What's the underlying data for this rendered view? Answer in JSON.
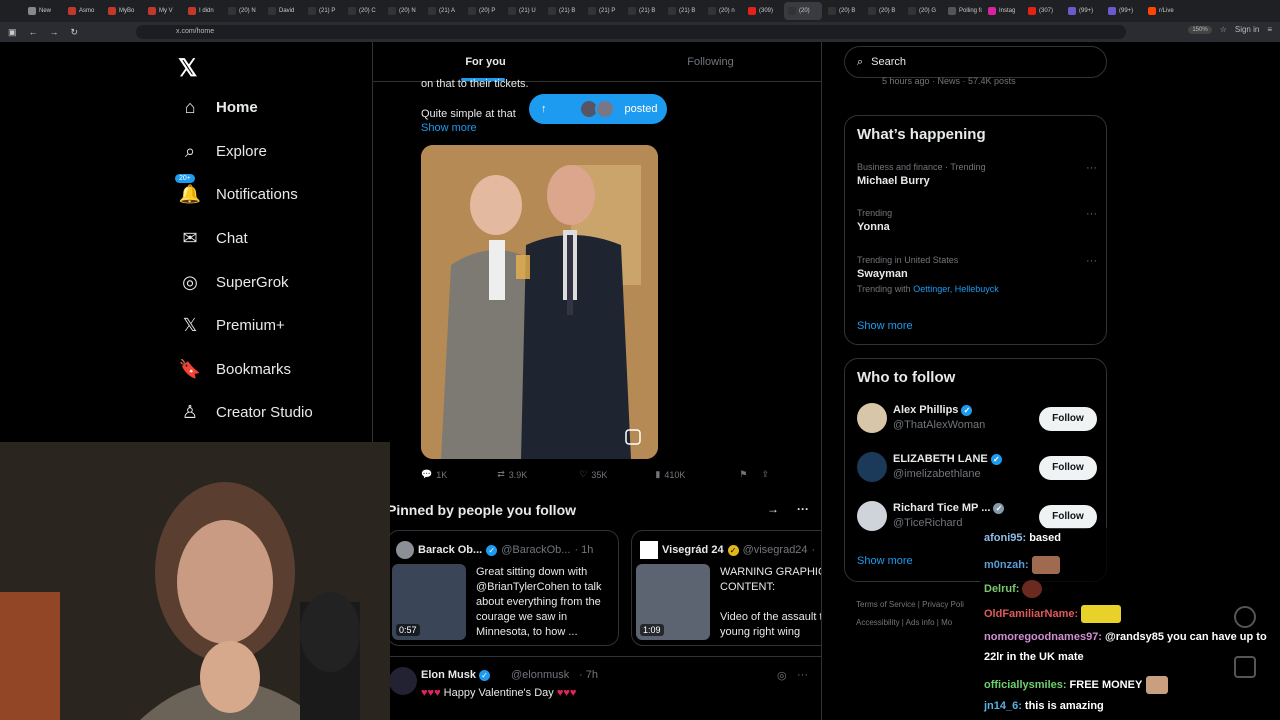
{
  "browser": {
    "tabs": [
      {
        "label": "New",
        "icon": "document-icon",
        "color": "#888"
      },
      {
        "label": "Asmo",
        "icon": "profile-icon",
        "color": "#c0392b"
      },
      {
        "label": "MyBo",
        "icon": "profile-icon",
        "color": "#c0392b"
      },
      {
        "label": "My V",
        "icon": "profile-icon",
        "color": "#c0392b"
      },
      {
        "label": "I didn",
        "icon": "profile-icon",
        "color": "#c0392b"
      },
      {
        "label": "(20) N",
        "icon": "x-icon",
        "color": "#333"
      },
      {
        "label": "David",
        "icon": "x-icon",
        "color": "#333"
      },
      {
        "label": "(21) P",
        "icon": "x-icon",
        "color": "#333"
      },
      {
        "label": "(20) C",
        "icon": "x-icon",
        "color": "#333"
      },
      {
        "label": "(20) N",
        "icon": "x-icon",
        "color": "#333"
      },
      {
        "label": "(21) A",
        "icon": "x-icon",
        "color": "#333"
      },
      {
        "label": "(20) P",
        "icon": "x-icon",
        "color": "#333"
      },
      {
        "label": "(21) U",
        "icon": "x-icon",
        "color": "#333"
      },
      {
        "label": "(21) B",
        "icon": "x-icon",
        "color": "#333"
      },
      {
        "label": "(21) P",
        "icon": "x-icon",
        "color": "#333"
      },
      {
        "label": "(21) B",
        "icon": "x-icon",
        "color": "#333"
      },
      {
        "label": "(21) B",
        "icon": "x-icon",
        "color": "#333"
      },
      {
        "label": "(20) n",
        "icon": "x-icon",
        "color": "#333"
      },
      {
        "label": "(309)",
        "icon": "youtube-icon",
        "color": "#e62117"
      },
      {
        "label": "(20)",
        "icon": "x-icon",
        "color": "#333",
        "active": true
      },
      {
        "label": "(20) B",
        "icon": "x-icon",
        "color": "#333"
      },
      {
        "label": "(20) B",
        "icon": "x-icon",
        "color": "#333"
      },
      {
        "label": "(20) G",
        "icon": "x-icon",
        "color": "#333"
      },
      {
        "label": "Polling fo",
        "icon": "document-icon",
        "color": "#555"
      },
      {
        "label": "Instag",
        "icon": "instagram-icon",
        "color": "#d6249f"
      },
      {
        "label": "(307)",
        "icon": "youtube-icon",
        "color": "#e62117"
      },
      {
        "label": "(99+)",
        "icon": "mail-icon",
        "color": "#6a5acd"
      },
      {
        "label": "(99+)",
        "icon": "mail-icon",
        "color": "#6a5acd"
      },
      {
        "label": "r/Live",
        "icon": "reddit-icon",
        "color": "#ff4500"
      }
    ],
    "url": "x.com/home",
    "zoom": "150%",
    "sign_in": "Sign in"
  },
  "leftnav": {
    "logo": "𝕏",
    "items": [
      {
        "label": "Home",
        "icon": "⌂",
        "name": "home"
      },
      {
        "label": "Explore",
        "icon": "⌕",
        "name": "explore"
      },
      {
        "label": "Notifications",
        "icon": "🔔",
        "name": "notifications",
        "badge": "20+"
      },
      {
        "label": "Chat",
        "icon": "✉",
        "name": "chat"
      },
      {
        "label": "SuperGrok",
        "icon": "◎",
        "name": "supergrok"
      },
      {
        "label": "Premium+",
        "icon": "𝕏",
        "name": "premium"
      },
      {
        "label": "Bookmarks",
        "icon": "🔖",
        "name": "bookmarks"
      },
      {
        "label": "Creator Studio",
        "icon": "♙",
        "name": "creator-studio"
      }
    ]
  },
  "feed": {
    "tabs": [
      "For you",
      "Following"
    ],
    "tweet_text_1": "on that to their tickets.",
    "tweet_text_2": "Quite simple at that",
    "show_more": "Show more",
    "posted_pill": "posted",
    "actions": {
      "replies": "1K",
      "reposts": "3.9K",
      "likes": "35K",
      "views": "410K"
    },
    "pinned_title": "Pinned by people you follow",
    "pinned": [
      {
        "name": "Barack Ob...",
        "handle": "@BarackOb...",
        "time": "· 1h",
        "duration": "0:57",
        "text": "Great sitting down with @BrianTylerCohen to talk about everything from the courage we saw in Minnesota, to how ..."
      },
      {
        "name": "Visegrád 24",
        "handle": "@visegrad24",
        "time": "·",
        "duration": "1:09",
        "text": "WARNING GRAPHIC CONTENT:\n\nVideo of the assault the young right wing"
      }
    ],
    "next_tweet": {
      "name": "Elon Musk",
      "handle": "@elonmusk",
      "time": "· 7h",
      "text": "Happy Valentine's Day"
    }
  },
  "right": {
    "search_placeholder": "Search",
    "prev_meta": "5 hours ago · News · 57.4K posts",
    "whats_happening": "What’s happening",
    "trends": [
      {
        "context": "Business and finance · Trending",
        "name": "Michael Burry"
      },
      {
        "context": "Trending",
        "name": "Yonna"
      },
      {
        "context": "Trending in United States",
        "name": "Swayman",
        "with_label": "Trending with",
        "with_links": "Oettinger, Hellebuyck"
      }
    ],
    "show_more": "Show more",
    "who_to_follow": "Who to follow",
    "follow": [
      {
        "name": "Alex Phillips",
        "handle": "@ThatAlexWoman"
      },
      {
        "name": "ELIZABETH LANE",
        "handle": "@imelizabethlane"
      },
      {
        "name": "Richard Tice MP ...",
        "handle": "@TiceRichard"
      }
    ],
    "follow_label": "Follow",
    "footer": [
      "Terms of Service",
      "Privacy Poli",
      "Accessibility",
      "Ads info",
      "Mo"
    ]
  },
  "chat": [
    {
      "user": "afoni95:",
      "color": "#8fbfe8",
      "text": "based"
    },
    {
      "user": "m0nzah:",
      "color": "#5a9bd4",
      "text": ""
    },
    {
      "user": "Delruf:",
      "color": "#7bc96f",
      "text": ""
    },
    {
      "user": "OldFamiliarName:",
      "color": "#e05a5a",
      "text": ""
    },
    {
      "user": "nomoregoodnames97:",
      "color": "#d18fd1",
      "text": "@randsy85 you can have up to"
    },
    {
      "user": "",
      "color": "#fff",
      "text": "22lr in the UK mate"
    },
    {
      "user": "officiallysmiles:",
      "color": "#6fcf6f",
      "text": "FREE MONEY"
    },
    {
      "user": "jn14_6:",
      "color": "#5ab0e0",
      "text": "this is amazing"
    }
  ]
}
